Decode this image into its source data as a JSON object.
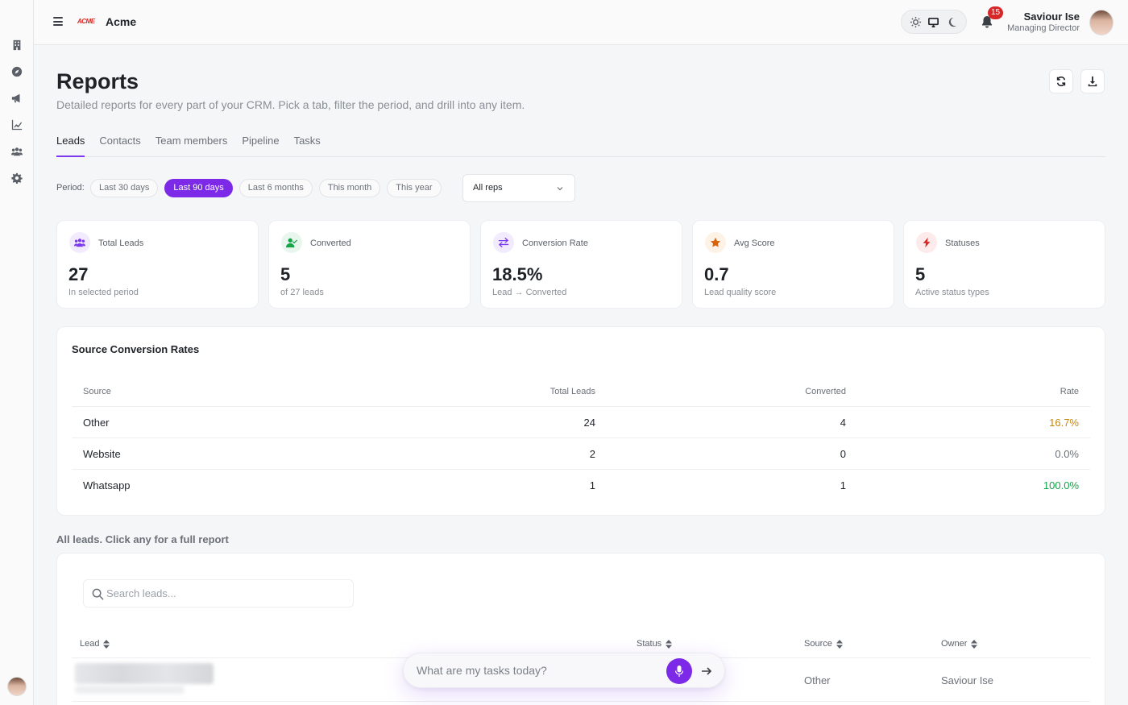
{
  "app": {
    "name": "Acme",
    "logo_text": "ACME"
  },
  "header": {
    "notifications_count": "15",
    "user": {
      "name": "Saviour Ise",
      "role": "Managing Director"
    },
    "theme_options": [
      "sun-icon",
      "monitor-icon",
      "moon-icon"
    ]
  },
  "sidebar": {
    "items": [
      {
        "name": "sidebar-item-documents",
        "icon": "building-icon"
      },
      {
        "name": "sidebar-item-explore",
        "icon": "compass-icon"
      },
      {
        "name": "sidebar-item-campaigns",
        "icon": "megaphone-icon"
      },
      {
        "name": "sidebar-item-reports",
        "icon": "chart-line-icon"
      },
      {
        "name": "sidebar-item-team",
        "icon": "users-icon"
      },
      {
        "name": "sidebar-item-settings",
        "icon": "gear-icon"
      }
    ]
  },
  "page": {
    "title": "Reports",
    "subtitle": "Detailed reports for every part of your CRM. Pick a tab, filter the period, and drill into any item."
  },
  "tabs": [
    {
      "label": "Leads",
      "active": true
    },
    {
      "label": "Contacts",
      "active": false
    },
    {
      "label": "Team members",
      "active": false
    },
    {
      "label": "Pipeline",
      "active": false
    },
    {
      "label": "Tasks",
      "active": false
    }
  ],
  "filters": {
    "period_label": "Period:",
    "periods": [
      {
        "label": "Last 30 days",
        "active": false
      },
      {
        "label": "Last 90 days",
        "active": true
      },
      {
        "label": "Last 6 months",
        "active": false
      },
      {
        "label": "This month",
        "active": false
      },
      {
        "label": "This year",
        "active": false
      }
    ],
    "rep_select": "All reps"
  },
  "stats": [
    {
      "label": "Total Leads",
      "value": "27",
      "sub": "In selected period",
      "icon": "users-icon",
      "color": "#7c3aed",
      "bg": "#f1ebfd"
    },
    {
      "label": "Converted",
      "value": "5",
      "sub": "of 27 leads",
      "icon": "user-check-icon",
      "color": "#16a34a",
      "bg": "#e8f6ee"
    },
    {
      "label": "Conversion Rate",
      "value": "18.5%",
      "sub": "Lead → Converted",
      "icon": "exchange-icon",
      "color": "#7c3aed",
      "bg": "#f1ebfd"
    },
    {
      "label": "Avg Score",
      "value": "0.7",
      "sub": "Lead quality score",
      "icon": "star-icon",
      "color": "#d9620f",
      "bg": "#fdf2e6"
    },
    {
      "label": "Statuses",
      "value": "5",
      "sub": "Active status types",
      "icon": "bolt-icon",
      "color": "#dc2626",
      "bg": "#fdeaea"
    }
  ],
  "source_table": {
    "title": "Source Conversion Rates",
    "headers": [
      "Source",
      "Total Leads",
      "Converted",
      "Rate"
    ],
    "rows": [
      {
        "source": "Other",
        "total": "24",
        "converted": "4",
        "rate": "16.7%",
        "tone": "warn"
      },
      {
        "source": "Website",
        "total": "2",
        "converted": "0",
        "rate": "0.0%",
        "tone": "zero"
      },
      {
        "source": "Whatsapp",
        "total": "1",
        "converted": "1",
        "rate": "100.0%",
        "tone": "good"
      }
    ]
  },
  "leads": {
    "section_label": "All leads. Click any for a full report",
    "search_placeholder": "Search leads...",
    "headers": {
      "lead": "Lead",
      "status": "Status",
      "source": "Source",
      "owner": "Owner"
    },
    "rows": [
      {
        "source": "Other",
        "owner": "Saviour Ise"
      }
    ]
  },
  "assistant": {
    "placeholder": "What are my tasks today?"
  }
}
